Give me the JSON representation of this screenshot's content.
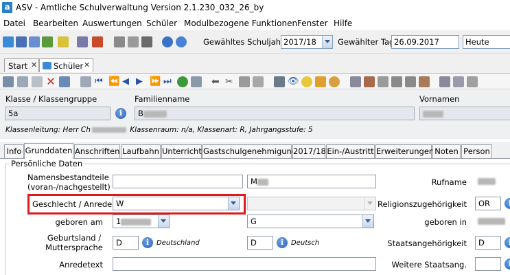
{
  "window": {
    "title": "ASV - Amtliche Schulverwaltung Version 2.1.230_032_26_by",
    "app_icon_letter": "a"
  },
  "menu": [
    "Datei",
    "Bearbeiten",
    "Auswertungen",
    "Schüler",
    "Modulbezogene Funktionen",
    "Fenster",
    "Hilfe"
  ],
  "toolbar": {
    "schuljahr_label": "Gewähltes Schuljahr",
    "schuljahr_value": "2017/18",
    "tag_label": "Gewählter Tag",
    "tag_value": "26.09.2017",
    "heute_value": "Heute"
  },
  "doc_tabs": [
    {
      "label": "Start"
    },
    {
      "label": "Schüler"
    }
  ],
  "header": {
    "klasse_label": "Klasse / Klassengruppe",
    "klasse_value": "5a",
    "familienname_label": "Familienname",
    "familienname_value": "B",
    "vornamen_label": "Vornamen",
    "klassenleitung": "Klassenleitung: Herr Ch",
    "klassen_info": "Klassenraum: n/a, Klassenart: R, Jahrgangsstufe: 5"
  },
  "register_tabs": [
    "Info",
    "Grunddaten",
    "Anschriften",
    "Laufbahn",
    "Unterricht",
    "Gastschulgenehmigung",
    "2017/18",
    "Ein-/Austritt",
    "Erweiterungen",
    "Noten",
    "Person"
  ],
  "active_register_tab": "Grunddaten",
  "form": {
    "group_title": "Persönliche Daten",
    "namensbestandteile_label_1": "Namensbestandteile",
    "namensbestandteile_label_2": "(voran-/nachgestellt)",
    "namensbestandteile_post_value": "M",
    "rufname_label": "Rufname",
    "geschlecht_label": "Geschlecht / Anrede",
    "geschlecht_value": "W",
    "religion_label": "Religionszugehörigkeit",
    "religion_value": "OR",
    "geboren_am_label": "geboren am",
    "geboren_am_value": "1",
    "g_value": "G",
    "geboren_in_label": "geboren in",
    "geburtsland_label_1": "Geburtsland /",
    "geburtsland_label_2": "Muttersprache",
    "geburtsland_value": "D",
    "geburtsland_text": "Deutschland",
    "muttersprache_value": "D",
    "muttersprache_text": "Deutsch",
    "staatsangehoerigkeit_label": "Staatsangehörigkeit",
    "staatsangehoerigkeit_value": "D",
    "anredetext_label": "Anredetext",
    "weitere_staatsang_label": "Weitere Staatsang."
  },
  "colors": {
    "highlight": "#e01818",
    "info_icon": "#2a62b8",
    "app_icon": "#2a7fc7"
  }
}
